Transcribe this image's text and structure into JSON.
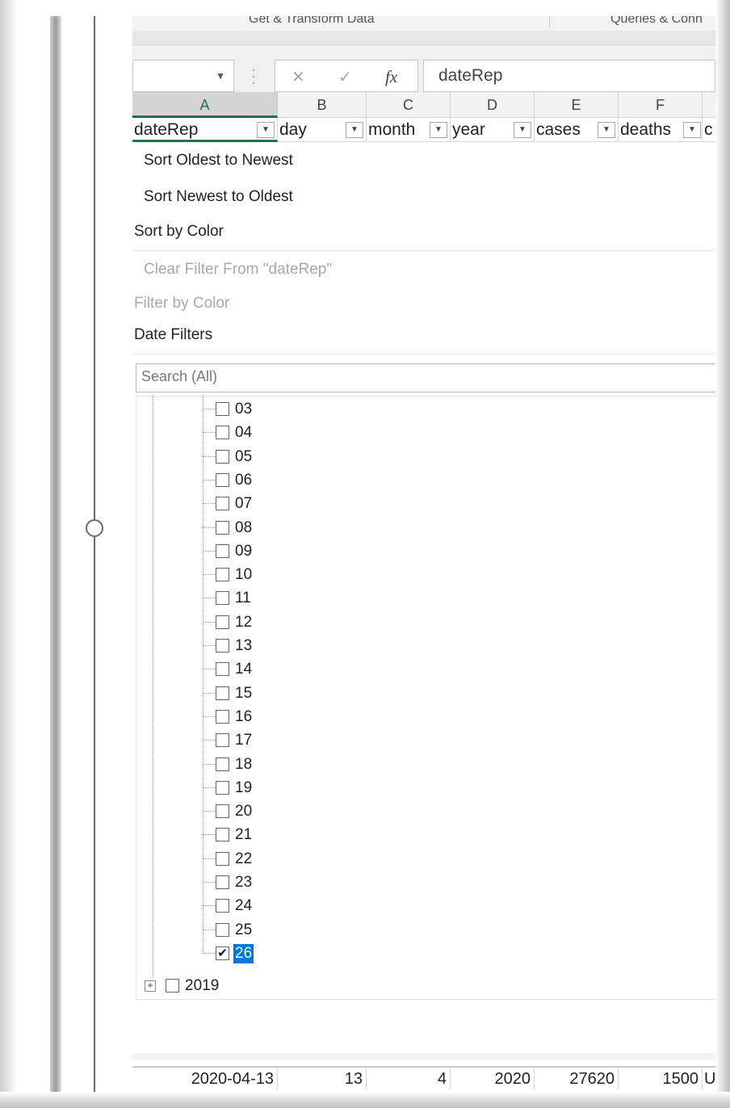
{
  "ribbon": {
    "group_get_transform": "Get & Transform Data",
    "group_queries": "Queries & Conn"
  },
  "formula_bar": {
    "cancel_icon": "✕",
    "enter_icon": "✓",
    "fx_label": "fx",
    "content": "dateRep"
  },
  "columns": [
    "A",
    "B",
    "C",
    "D",
    "E",
    "F"
  ],
  "header_row": {
    "cells": [
      "dateRep",
      "day",
      "month",
      "year",
      "cases",
      "deaths",
      "c"
    ]
  },
  "filter_menu": {
    "sort_asc": "Sort Oldest to Newest",
    "sort_desc": "Sort Newest to Oldest",
    "sort_by_color": "Sort by Color",
    "clear_filter": "Clear Filter From \"dateRep\"",
    "filter_by_color": "Filter by Color",
    "date_filters": "Date Filters",
    "search_placeholder": "Search (All)",
    "day_items": [
      {
        "label": "03",
        "checked": false
      },
      {
        "label": "04",
        "checked": false
      },
      {
        "label": "05",
        "checked": false
      },
      {
        "label": "06",
        "checked": false
      },
      {
        "label": "07",
        "checked": false
      },
      {
        "label": "08",
        "checked": false
      },
      {
        "label": "09",
        "checked": false
      },
      {
        "label": "10",
        "checked": false
      },
      {
        "label": "11",
        "checked": false
      },
      {
        "label": "12",
        "checked": false
      },
      {
        "label": "13",
        "checked": false
      },
      {
        "label": "14",
        "checked": false
      },
      {
        "label": "15",
        "checked": false
      },
      {
        "label": "16",
        "checked": false
      },
      {
        "label": "17",
        "checked": false
      },
      {
        "label": "18",
        "checked": false
      },
      {
        "label": "19",
        "checked": false
      },
      {
        "label": "20",
        "checked": false
      },
      {
        "label": "21",
        "checked": false
      },
      {
        "label": "22",
        "checked": false
      },
      {
        "label": "23",
        "checked": false
      },
      {
        "label": "24",
        "checked": false
      },
      {
        "label": "25",
        "checked": false
      },
      {
        "label": "26",
        "checked": true
      }
    ],
    "year_node": {
      "label": "2019",
      "expander": "+",
      "checked": false
    }
  },
  "data_row": {
    "cells": [
      "2020-04-13",
      "13",
      "4",
      "2020",
      "27620",
      "1500",
      "U"
    ]
  },
  "colors": {
    "excel_green": "#217346",
    "selection_blue": "#0078d7"
  }
}
